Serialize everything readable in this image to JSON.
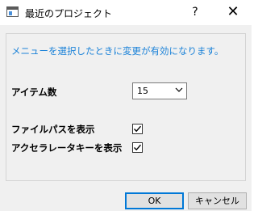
{
  "window": {
    "title": "最近のプロジェクト",
    "help_label": "?",
    "close_label": "✕"
  },
  "dialog": {
    "hint": "メニューを選択したときに変更が有効になります。",
    "items_label": "アイテム数",
    "items_value": "15",
    "show_path_label": "ファイルパスを表示",
    "show_path_checked": true,
    "show_accel_label": "アクセラレータキーを表示",
    "show_accel_checked": true
  },
  "buttons": {
    "ok": "OK",
    "cancel": "キャンセル"
  },
  "colors": {
    "hint": "#1b82d8",
    "dialog_bg": "#f0f0f0",
    "default_button_border": "#0078d7"
  },
  "icons": {
    "app": "window-app-icon",
    "dropdown": "chevron-down-icon",
    "check": "checkmark-icon"
  }
}
